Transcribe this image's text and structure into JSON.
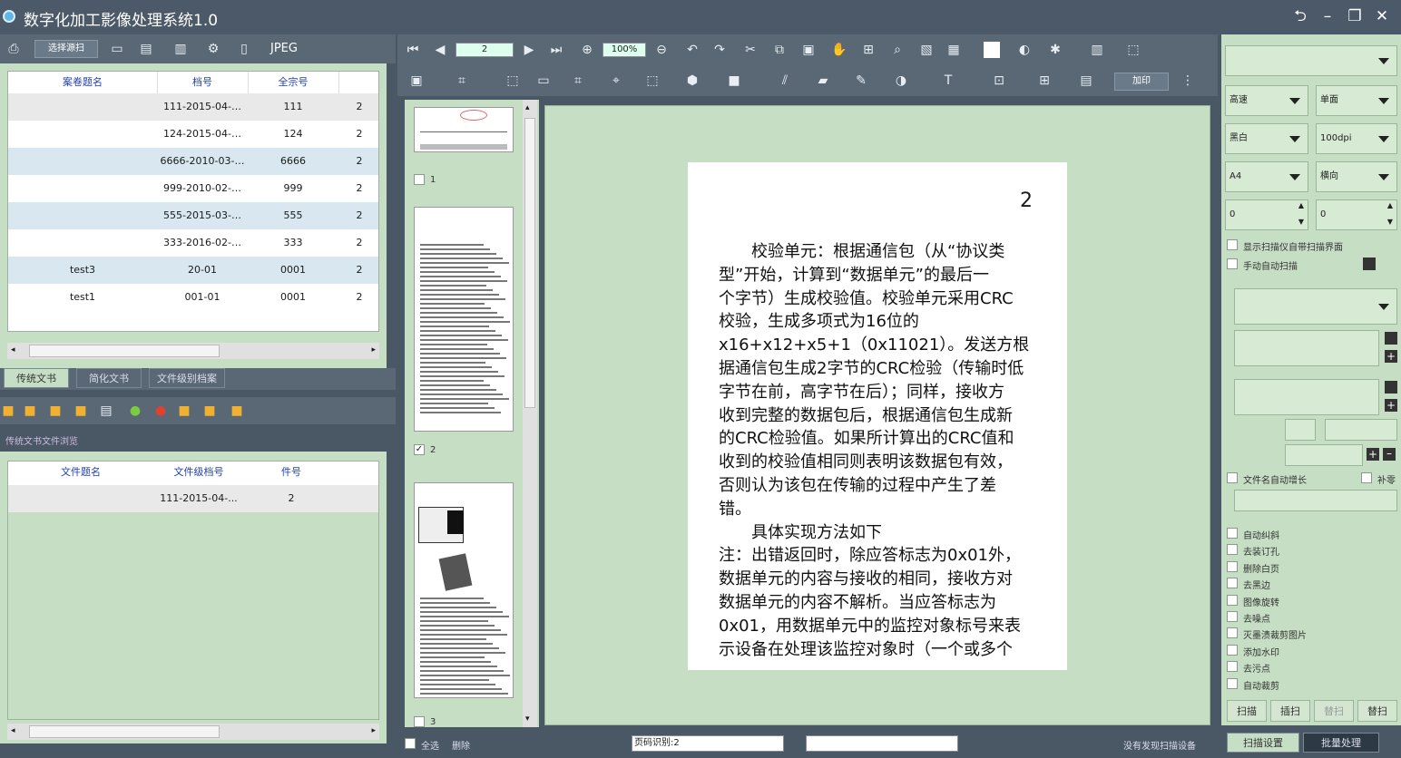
{
  "window": {
    "title": "数字化加工影像处理系统1.0",
    "back": "⮌",
    "minimize": "–",
    "restore": "❐",
    "close": "✕"
  },
  "left_toolbar": {
    "scan_icon": "⎙",
    "select_device": "选择源扫",
    "format": "JPEG"
  },
  "archive_table": {
    "headers": [
      "案卷题名",
      "档号",
      "全宗号",
      ""
    ],
    "rows": [
      {
        "title": "",
        "code": "111-2015-04-…",
        "fonds": "111",
        "extra": "2"
      },
      {
        "title": "",
        "code": "124-2015-04-…",
        "fonds": "124",
        "extra": "2"
      },
      {
        "title": "",
        "code": "6666-2010-03-…",
        "fonds": "6666",
        "extra": "2"
      },
      {
        "title": "",
        "code": "999-2010-02-…",
        "fonds": "999",
        "extra": "2"
      },
      {
        "title": "",
        "code": "555-2015-03-…",
        "fonds": "555",
        "extra": "2"
      },
      {
        "title": "",
        "code": "333-2016-02-…",
        "fonds": "333",
        "extra": "2"
      },
      {
        "title": "test3",
        "code": "20-01",
        "fonds": "0001",
        "extra": "2"
      },
      {
        "title": "test1",
        "code": "001-01",
        "fonds": "0001",
        "extra": "2"
      }
    ]
  },
  "left_tabs": [
    "传统文书",
    "简化文书",
    "文件级别档案"
  ],
  "file_section": {
    "caption": "传统文书文件浏览",
    "headers": [
      "文件题名",
      "文件级档号",
      "件号",
      ""
    ],
    "rows": [
      {
        "title": "",
        "code": "111-2015-04-...",
        "num": "2",
        "extra": ""
      }
    ]
  },
  "viewer_toolbar": {
    "page": "2",
    "zoom": "100%",
    "apply": "加印"
  },
  "thumbnails": [
    {
      "label": "1",
      "checked": false
    },
    {
      "label": "2",
      "checked": true
    },
    {
      "label": "3",
      "checked": false
    }
  ],
  "document": {
    "page_number": "2",
    "lines": [
      "　　校验单元：根据通信包（从“协议类",
      "型”开始，计算到“数据单元”的最后一",
      "个字节）生成校验值。校验单元采用CRC",
      "校验，生成多项式为16位的",
      "x16+x12+x5+1（0x11021）。发送方根",
      "据通信包生成2字节的CRC检验（传输时低",
      "字节在前，高字节在后）；同样，接收方",
      "收到完整的数据包后，根据通信包生成新",
      "的CRC检验值。如果所计算出的CRC值和",
      "收到的校验值相同则表明该数据包有效，",
      "否则认为该包在传输的过程中产生了差",
      "错。",
      "　　具体实现方法如下",
      "注：出错返回时，除应答标志为0x01外，",
      "数据单元的内容与接收的相同，接收方对",
      "数据单元的内容不解析。当应答标志为",
      "0x01，用数据单元中的监控对象标号来表",
      "示设备在处理该监控对象时（一个或多个"
    ]
  },
  "right_panel": {
    "combo_top": "",
    "combos": [
      {
        "a": "高速",
        "b": "单面"
      },
      {
        "a": "黑白",
        "b": "100dpi"
      },
      {
        "a": "A4",
        "b": "横向"
      }
    ],
    "spins": {
      "a": "0",
      "b": "0"
    },
    "opt1": "显示扫描仪自带扫描界面",
    "opt2": "手动自动扫描",
    "auto_name": "文件名自动增长",
    "auto_name2": "补零",
    "options": [
      "自动纠斜",
      "去装订孔",
      "删除白页",
      "去黑边",
      "图像旋转",
      "去噪点",
      "灭墨渍裁剪图片",
      "添加水印",
      "去污点",
      "自动裁剪"
    ],
    "buttons": [
      "扫描",
      "插扫",
      "替扫",
      "替扫"
    ],
    "bottom_tabs": [
      "扫描设置",
      "批量处理"
    ]
  },
  "statusbar": {
    "select_all": "全选",
    "delete": "删除",
    "page_info": "页码识别:2",
    "scanner": "没有发现扫描设备"
  }
}
